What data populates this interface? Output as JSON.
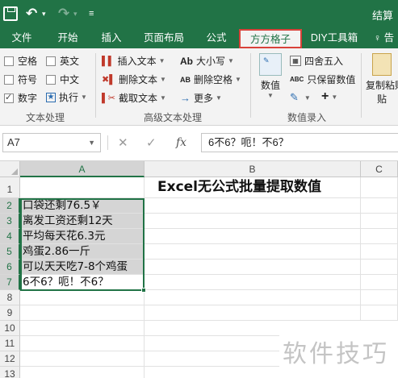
{
  "titlebar": {
    "right_text": "结算",
    "icons": [
      "save-icon",
      "undo-icon",
      "redo-icon",
      "customize-quick-access-icon"
    ]
  },
  "tabs": [
    {
      "label": "文件"
    },
    {
      "label": "开始"
    },
    {
      "label": "插入"
    },
    {
      "label": "页面布局"
    },
    {
      "label": "公式"
    },
    {
      "label": "方方格子",
      "active": true
    },
    {
      "label": "DIY工具箱"
    },
    {
      "label": "♀ 告"
    }
  ],
  "ribbon": {
    "text_processing": {
      "label": "文本处理",
      "checkboxes": [
        {
          "label": "空格",
          "checked": false
        },
        {
          "label": "英文",
          "checked": false
        },
        {
          "label": "符号",
          "checked": false
        },
        {
          "label": "中文",
          "checked": false
        },
        {
          "label": "数字",
          "checked": true
        }
      ],
      "execute_label": "执行"
    },
    "advanced_text": {
      "label": "高级文本处理",
      "buttons": [
        "插入文本",
        "删除文本",
        "截取文本",
        "大小写",
        "删除空格",
        "更多"
      ],
      "icon_texts": [
        "Ab",
        "AB"
      ]
    },
    "number_entry": {
      "label": "数值录入",
      "big_button": "数值",
      "buttons": [
        "四舍五入",
        "只保留数值"
      ],
      "icon_texts": [
        "ABC"
      ],
      "plus_label": "+"
    },
    "paste": {
      "label": "复制粘贴",
      "line2": "贴"
    }
  },
  "formula_bar": {
    "name_box": "A7",
    "fx": "fx",
    "content": "6不6？呃！不6？"
  },
  "grid": {
    "columns": [
      "A",
      "B",
      "C"
    ],
    "rows": [
      "1",
      "2",
      "3",
      "4",
      "5",
      "6",
      "7",
      "8",
      "9",
      "10",
      "11",
      "12",
      "13"
    ],
    "title": "Excel无公式批量提取数值",
    "cells_a": [
      "",
      "口袋还剩76.5￥",
      "离发工资还剩12天",
      "平均每天花6.3元",
      "鸡蛋2.86一斤",
      "可以天天吃7-8个鸡蛋",
      "6不6？呃！不6？"
    ]
  },
  "watermark": "软件技巧",
  "colors": {
    "excel_green": "#217346",
    "active_tab_border": "#d9423a",
    "selection_fill": "#d5d5d5"
  }
}
